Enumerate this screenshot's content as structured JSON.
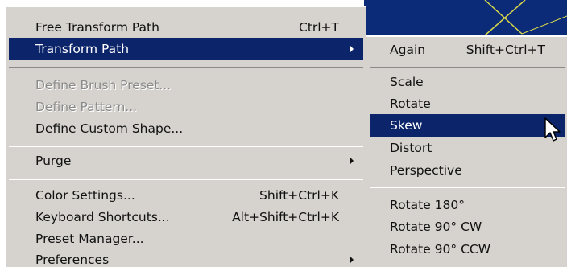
{
  "main_menu": {
    "items": [
      {
        "label": "Free Transform Path",
        "shortcut": "Ctrl+T"
      },
      {
        "label": "Transform Path",
        "shortcut": ""
      },
      {
        "label": "Define Brush Preset...",
        "shortcut": ""
      },
      {
        "label": "Define Pattern...",
        "shortcut": ""
      },
      {
        "label": "Define Custom Shape...",
        "shortcut": ""
      },
      {
        "label": "Purge",
        "shortcut": ""
      },
      {
        "label": "Color Settings...",
        "shortcut": "Shift+Ctrl+K"
      },
      {
        "label": "Keyboard Shortcuts...",
        "shortcut": "Alt+Shift+Ctrl+K"
      },
      {
        "label": "Preset Manager...",
        "shortcut": ""
      },
      {
        "label": "Preferences",
        "shortcut": ""
      }
    ]
  },
  "submenu": {
    "items": [
      {
        "label": "Again",
        "shortcut": "Shift+Ctrl+T"
      },
      {
        "label": "Scale",
        "shortcut": ""
      },
      {
        "label": "Rotate",
        "shortcut": ""
      },
      {
        "label": "Skew",
        "shortcut": ""
      },
      {
        "label": "Distort",
        "shortcut": ""
      },
      {
        "label": "Perspective",
        "shortcut": ""
      },
      {
        "label": "Rotate 180°",
        "shortcut": ""
      },
      {
        "label": "Rotate 90° CW",
        "shortcut": ""
      },
      {
        "label": "Rotate 90° CCW",
        "shortcut": ""
      }
    ]
  },
  "colors": {
    "menu_bg": "#d6d3ce",
    "highlight": "#0b246a",
    "disabled_text": "#8a8a8a",
    "canvas_bg": "#0b2a78",
    "canvas_lines": "#d8d84a"
  },
  "icons": {
    "submenu_arrow": "triangle-right",
    "cursor": "arrow-pointer"
  }
}
